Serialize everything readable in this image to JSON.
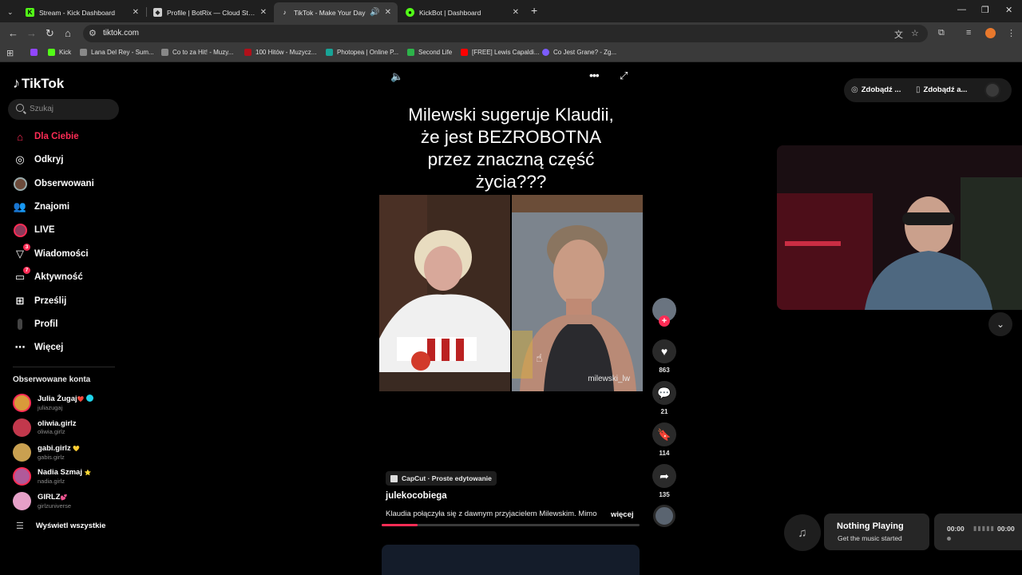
{
  "browser": {
    "tabs": [
      {
        "title": "Stream - Kick Dashboard",
        "icon": "kick-icon",
        "color": "#53fc18"
      },
      {
        "title": "Profile | BotRix — Cloud Stream",
        "icon": "botrix-icon",
        "color": "#cfcfcf"
      },
      {
        "title": "TikTok - Make Your Day",
        "icon": "tiktok-icon",
        "color": "#ffffff",
        "active": true
      },
      {
        "title": "KickBot | Dashboard",
        "icon": "kickbot-icon",
        "color": "#53fc18"
      }
    ],
    "url": "tiktok.com",
    "bookmarks": [
      {
        "label": "Kick",
        "color": "#53fc18"
      },
      {
        "label": "Lana Del Rey - Sum...",
        "color": "#888888"
      },
      {
        "label": "Co to za Hit! - Muzy...",
        "color": "#888888"
      },
      {
        "label": "100 Hitów - Muzycz...",
        "color": "#b0101a"
      },
      {
        "label": "Photopea | Online P...",
        "color": "#18a497"
      },
      {
        "label": "Second Life",
        "color": "#2db34a"
      },
      {
        "label": "[FREE] Lewis Capaldi...",
        "color": "#ff0000"
      },
      {
        "label": "Co Jest Grane? - Zg...",
        "color": "#7c5cff"
      }
    ]
  },
  "tiktok": {
    "logo": "TikTok",
    "search_placeholder": "Szukaj",
    "nav": [
      {
        "label": "Dla Ciebie",
        "icon": "home-icon",
        "active": true
      },
      {
        "label": "Odkryj",
        "icon": "compass-icon"
      },
      {
        "label": "Obserwowani",
        "icon": "following-avatar-icon"
      },
      {
        "label": "Znajomi",
        "icon": "friends-icon"
      },
      {
        "label": "LIVE",
        "icon": "live-avatar-icon"
      },
      {
        "label": "Wiadomości",
        "icon": "messages-icon",
        "badge": "3"
      },
      {
        "label": "Aktywność",
        "icon": "activity-icon",
        "badge": "7"
      },
      {
        "label": "Prześlij",
        "icon": "upload-icon"
      },
      {
        "label": "Profil",
        "icon": "profile-icon"
      },
      {
        "label": "Więcej",
        "icon": "more-icon"
      }
    ],
    "followed_title": "Obserwowane konta",
    "accounts": [
      {
        "name": "Julia Żugaj",
        "suffix": "❤️",
        "user": "juliazugaj",
        "verified": true,
        "color": "#d99a3a"
      },
      {
        "name": "oliwia.girlz",
        "suffix": "",
        "user": "oliwia.girlz",
        "verified": false,
        "color": "#c2384c"
      },
      {
        "name": "gabi.girlz",
        "suffix": "💛",
        "user": "gabis.girlz",
        "verified": false,
        "color": "#c9a050"
      },
      {
        "name": "Nadia Szmaj",
        "suffix": "⭐",
        "user": "nadia.girlz",
        "verified": false,
        "color": "#b05a9a"
      },
      {
        "name": "GIRLZ",
        "suffix": "💕",
        "user": "girlzuniverse",
        "verified": false,
        "color": "#e6a0c8"
      }
    ],
    "see_all": "Wyświetl wszystkie"
  },
  "video": {
    "title_lines": [
      "Milewski sugeruje Klaudii,",
      "że jest BEZROBOTNA",
      "przez znaczną część",
      "życia???"
    ],
    "watermark": "milewski_lw",
    "likes": "863",
    "comments": "21",
    "saves": "114",
    "shares": "135",
    "capcut": "CapCut · Proste edytowanie",
    "author": "julekocobiega",
    "description": "Klaudia połączyła się z dawnym przyjacielem Milewskim. Mimo",
    "more": "więcej",
    "progress": 0.14
  },
  "right": {
    "get_coins": "Zdobądź ...",
    "get_app": "Zdobądź a...",
    "music_title": "Nothing Playing",
    "music_subtitle": "Get the music started",
    "time_start": "00:00",
    "time_end": "00:00"
  }
}
